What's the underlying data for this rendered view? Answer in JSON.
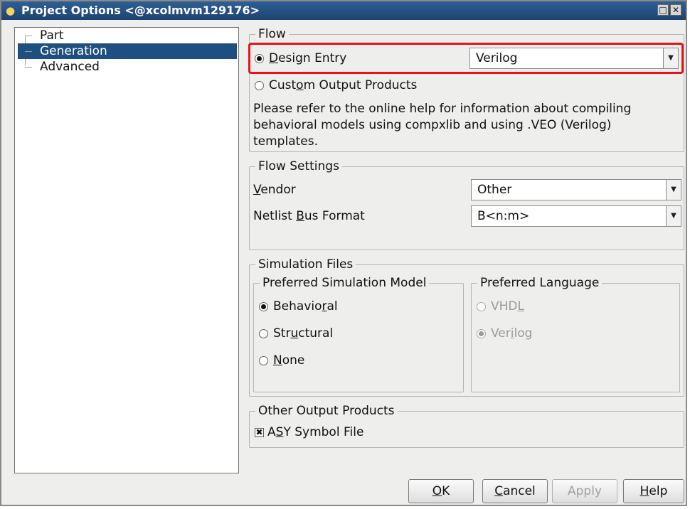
{
  "window": {
    "title": "Project Options <@xcolmvm129176>"
  },
  "tree": {
    "items": [
      "Part",
      "Generation",
      "Advanced"
    ],
    "selected": "Generation"
  },
  "flow": {
    "legend": "Flow",
    "design_entry": {
      "label_pre": "",
      "accel": "D",
      "label_post": "esign Entry",
      "selected": true,
      "value": "Verilog"
    },
    "custom_output": {
      "label_pre": "Cust",
      "accel": "o",
      "label_post": "m Output Products",
      "selected": false
    },
    "help_text": [
      "Please refer to the online help for information about compiling",
      "behavioral models using compxlib and using .VEO (Verilog)",
      "templates."
    ]
  },
  "flow_settings": {
    "legend": "Flow Settings",
    "vendor": {
      "label_pre": "",
      "accel": "V",
      "label_post": "endor",
      "value": "Other"
    },
    "netlist": {
      "label_pre": "Netlist ",
      "accel": "B",
      "label_post": "us Format",
      "value": "B<n:m>"
    }
  },
  "simulation": {
    "legend": "Simulation Files",
    "model": {
      "legend": "Preferred Simulation Model",
      "options": [
        {
          "pre": "Behavio",
          "accel": "r",
          "post": "al",
          "selected": true
        },
        {
          "pre": "Str",
          "accel": "u",
          "post": "ctural",
          "selected": false
        },
        {
          "pre": "",
          "accel": "N",
          "post": "one",
          "selected": false
        }
      ]
    },
    "language": {
      "legend": "Preferred Language",
      "options": [
        {
          "pre": "VHD",
          "accel": "L",
          "post": "",
          "selected": false
        },
        {
          "pre": "Ver",
          "accel": "i",
          "post": "log",
          "selected": true
        }
      ]
    }
  },
  "other_outputs": {
    "legend": "Other Output Products",
    "asy": {
      "pre": "A",
      "accel": "S",
      "post": "Y Symbol File",
      "checked": true,
      "check_glyph": "✖"
    }
  },
  "buttons": {
    "ok": {
      "pre": "",
      "accel": "O",
      "post": "K"
    },
    "cancel": {
      "pre": "",
      "accel": "C",
      "post": "ancel"
    },
    "apply": {
      "label": "Apply"
    },
    "help": {
      "pre": "",
      "accel": "H",
      "post": "elp"
    }
  },
  "colors": {
    "highlight": "#e2141c",
    "selection": "#1f4f80",
    "titlebar": "#1c4371"
  },
  "icons": {
    "title": "bulb-icon",
    "restore": "maximize-icon",
    "close": "close-icon",
    "dropdown": "chevron-down-icon"
  }
}
